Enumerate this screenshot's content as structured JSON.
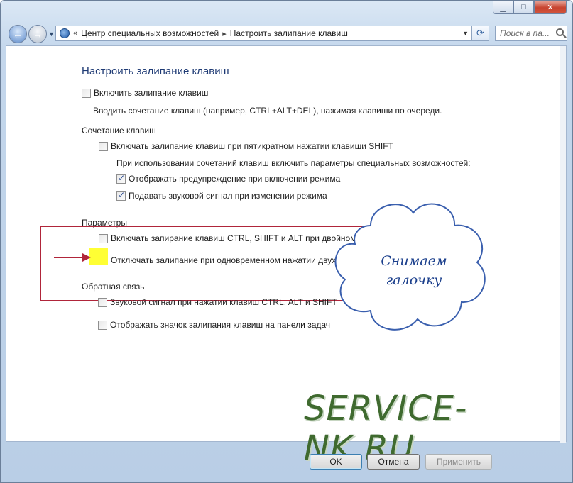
{
  "window": {
    "caption_buttons": [
      "minimize",
      "maximize",
      "close"
    ]
  },
  "nav": {
    "breadcrumbs": [
      "Центр специальных возможностей",
      "Настроить залипание клавиш"
    ],
    "separator": "«",
    "arrow": "▸",
    "search_placeholder": "Поиск в па..."
  },
  "page": {
    "title": "Настроить залипание клавиш",
    "enable_label": "Включить залипание клавиш",
    "enable_checked": false,
    "enable_description": "Вводить сочетание клавиш (например, CTRL+ALT+DEL), нажимая клавиши по очереди.",
    "shortcut_group": {
      "header": "Сочетание клавиш",
      "shift_label": "Включать залипание клавиш при пятикратном нажатии клавиши SHIFT",
      "shift_checked": false,
      "note": "При использовании сочетаний клавиш включить параметры специальных возможностей:",
      "warn_label": "Отображать предупреждение при включении режима",
      "warn_checked": true,
      "sound_label": "Подавать звуковой сигнал при изменении режима",
      "sound_checked": true
    },
    "options_group": {
      "header": "Параметры",
      "lock_label": "Включать запирание клавиш CTRL, SHIFT и ALT при двойном нажатии",
      "lock_checked": false,
      "off_label": "Отключать залипание при одновременном нажатии двух клавиш",
      "off_checked": false
    },
    "feedback_group": {
      "header": "Обратная связь",
      "beep_label": "Звуковой сигнал при нажатии клавиш CTRL, ALT и SHIFT",
      "beep_checked": false,
      "icon_label": "Отображать значок залипания клавиш на панели задач",
      "icon_checked": false
    }
  },
  "annotation": {
    "cloud_line1": "Снимаем",
    "cloud_line2": "галочку",
    "watermark": "SERVICE-NK.RU"
  },
  "buttons": {
    "ok": "OK",
    "cancel": "Отмена",
    "apply": "Применить"
  },
  "colors": {
    "highlight_box": "#b0253a",
    "marker": "#ffff34",
    "cloud_text": "#1b3f8c",
    "title": "#1e3a74"
  }
}
